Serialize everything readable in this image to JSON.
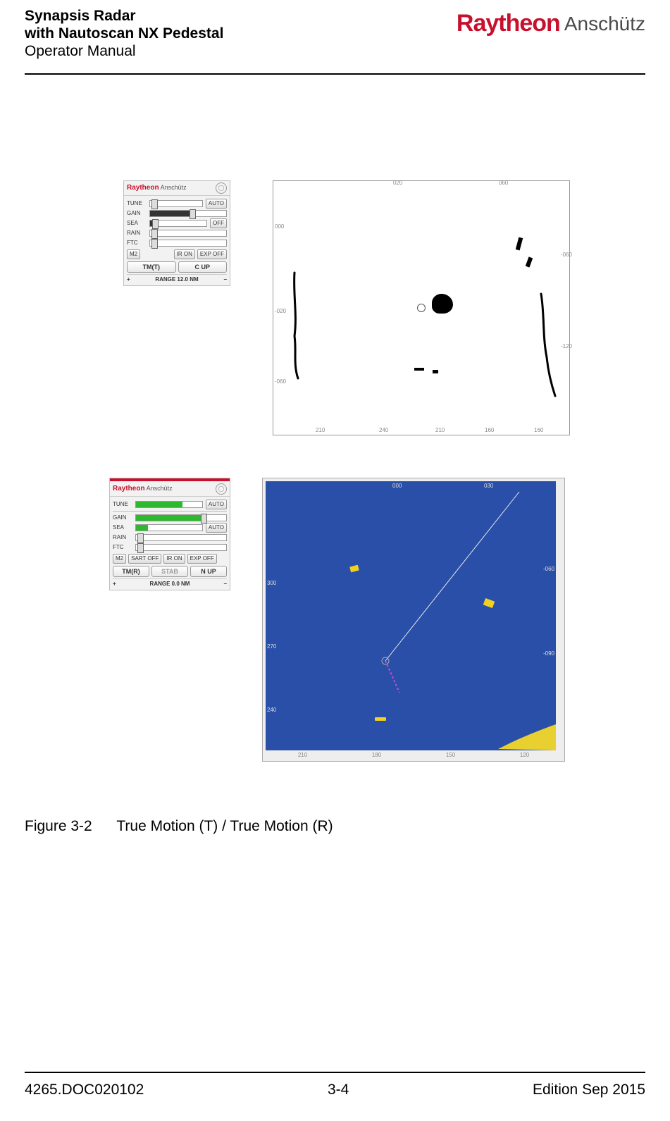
{
  "header": {
    "title_line1": "Synapsis Radar",
    "title_line2": "with Nautoscan NX Pedestal",
    "title_line3": "Operator Manual",
    "logo_raytheon": "Raytheon",
    "logo_anschutz": "Anschütz"
  },
  "panel1": {
    "brand_r": "Raytheon",
    "brand_a": "Anschütz",
    "tune_label": "TUNE",
    "tune_btn": "AUTO",
    "gain_label": "GAIN",
    "sea_label": "SEA",
    "sea_btn": "OFF",
    "rain_label": "RAIN",
    "ftc_label": "FTC",
    "m2": "M2",
    "ir": "IR ON",
    "exp": "EXP OFF",
    "tm": "TM(T)",
    "cup": "C UP",
    "range_plus": "+",
    "range_text": "RANGE 12.0 NM",
    "range_minus": "−"
  },
  "panel2": {
    "brand_r": "Raytheon",
    "brand_a": "Anschütz",
    "tune_label": "TUNE",
    "tune_btn": "AUTO",
    "gain_label": "GAIN",
    "sea_label": "SEA",
    "sea_btn": "AUTO",
    "rain_label": "RAIN",
    "ftc_label": "FTC",
    "m2": "M2",
    "sart": "SART OFF",
    "ir": "IR ON",
    "exp": "EXP OFF",
    "tm": "TM(R)",
    "stab": "STAB",
    "nup": "N UP",
    "range_plus": "+",
    "range_text": "RANGE 0.0 NM",
    "range_minus": "−"
  },
  "radar_top": {
    "top1": "020",
    "top2": "060",
    "right1": "-060",
    "right2": "-120",
    "left1": "000",
    "left2": "-020",
    "left3": "-060",
    "bot1": "210",
    "bot2": "240",
    "bot3": "210",
    "bot4": "160",
    "bot5": "160"
  },
  "radar_bottom": {
    "top1": "000",
    "top2": "030",
    "right1": "-060",
    "right2": "-090",
    "left1": "300",
    "left2": "270",
    "left3": "240",
    "bottom_outer1": "210",
    "bottom_outer2": "180",
    "bottom_outer3": "150",
    "bottom_outer4": "120"
  },
  "caption": {
    "fig_no": "Figure 3-2",
    "fig_text": "True Motion (T) / True Motion (R)"
  },
  "footer": {
    "doc": "4265.DOC020102",
    "page": "3-4",
    "edition": "Edition Sep 2015"
  }
}
